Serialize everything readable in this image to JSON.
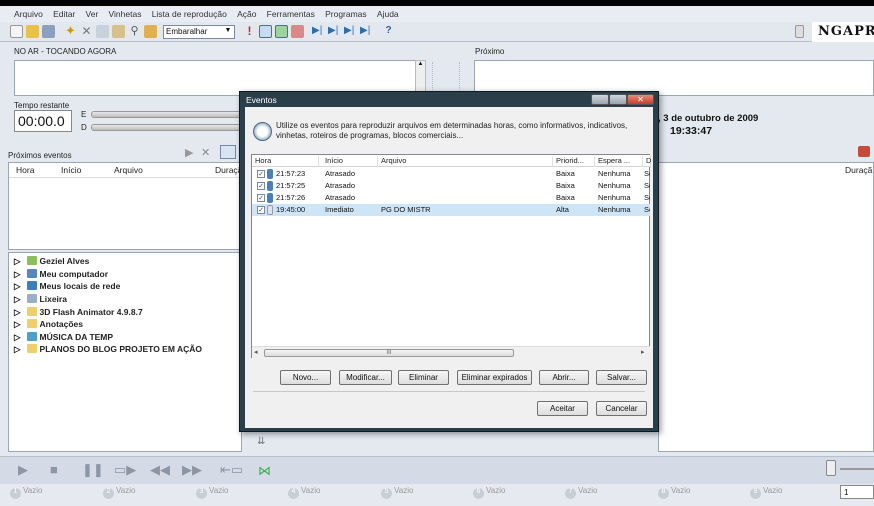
{
  "menu": [
    "Arquivo",
    "Editar",
    "Ver",
    "Vinhetas",
    "Lista de reprodução",
    "Ação",
    "Ferramentas",
    "Programas",
    "Ajuda"
  ],
  "toolbar": {
    "combo_value": "Embaralhar",
    "logo_text": "NGAPR"
  },
  "onair": {
    "label": "NO AR - TOCANDO AGORA",
    "remaining_label": "Tempo restante",
    "remaining_value": "00:00.0",
    "e_label": "E",
    "d_label": "D"
  },
  "next": {
    "label": "Próximo"
  },
  "clock": {
    "date": ", 3 de outubro de 2009",
    "time": "19:33:47"
  },
  "upcoming": {
    "label": "Próximos eventos",
    "columns": [
      "Hora",
      "Início",
      "Arquivo",
      "Duraçã"
    ],
    "right_duration": "Duraçã"
  },
  "tree": [
    "Geziel Alves",
    "Meu computador",
    "Meus locais de rede",
    "Lixeira",
    "3D Flash Animator 4.9.8.7",
    "Anotações",
    "MÚSICA DA TEMP",
    "PLANOS DO BLOG PROJETO EM AÇÃO"
  ],
  "slots": [
    "Vazio",
    "Vazio",
    "Vazio",
    "Vazio",
    "Vazio",
    "Vazio",
    "Vazio",
    "Vazio",
    "Vazio"
  ],
  "slot_numbers": [
    "1",
    "2",
    "3",
    "4",
    "5",
    "6",
    "7",
    "8",
    "9"
  ],
  "page_field": "1",
  "dialog": {
    "title": "Eventos",
    "description": "Utilize os eventos para reproduzir arquivos em determinadas horas, como informativos, indicativos, vinhetas, roteiros de programas, blocos comerciais...",
    "columns": [
      "Hora",
      "Início",
      "Arquivo",
      "Priorid...",
      "Espera ...",
      "D"
    ],
    "rows": [
      {
        "hora": "21:57:23",
        "inicio": "Atrasado",
        "arquivo": "",
        "prioridade": "Baixa",
        "espera": "Nenhuma",
        "d": "Se",
        "checked": "✓",
        "selected": false
      },
      {
        "hora": "21:57:25",
        "inicio": "Atrasado",
        "arquivo": "",
        "prioridade": "Baixa",
        "espera": "Nenhuma",
        "d": "Se",
        "checked": "✓",
        "selected": false
      },
      {
        "hora": "21:57:26",
        "inicio": "Atrasado",
        "arquivo": "",
        "prioridade": "Baixa",
        "espera": "Nenhuma",
        "d": "Se",
        "checked": "✓",
        "selected": false
      },
      {
        "hora": "19:45:00",
        "inicio": "Imediato",
        "arquivo": "PG DO MISTR",
        "prioridade": "Alta",
        "espera": "Nenhuma",
        "d": "Se",
        "checked": "✓",
        "selected": true
      }
    ],
    "scroll_grip": "III",
    "buttons": {
      "new": "Novo...",
      "modify": "Modificar...",
      "delete": "Eliminar",
      "delete_expired": "Eliminar expirados",
      "open": "Abrir...",
      "save": "Salvar...",
      "ok": "Aceitar",
      "cancel": "Cancelar"
    }
  },
  "colors": {
    "accent": "#cde5f7",
    "dialog_frame": "#2b3f4a",
    "close_button": "#c5402a"
  }
}
